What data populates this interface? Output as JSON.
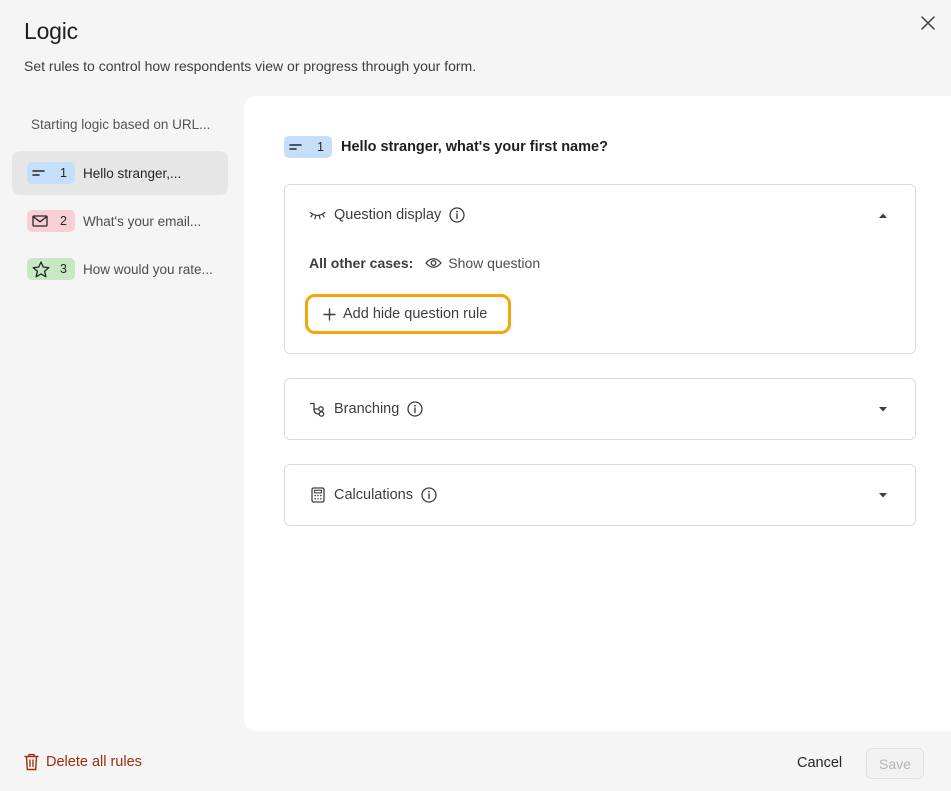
{
  "modal": {
    "title": "Logic",
    "subtitle": "Set rules to control how respondents view or progress through your form.",
    "close_icon": "close-icon"
  },
  "sidebar": {
    "header": "Starting logic based on URL...",
    "items": [
      {
        "number": "1",
        "label": "Hello stranger,...",
        "icon": "short-text-icon",
        "color": "#c5dffa",
        "active": true
      },
      {
        "number": "2",
        "label": "What's your email...",
        "icon": "mail-icon",
        "color": "#f9cfd6",
        "active": false
      },
      {
        "number": "3",
        "label": "How would you rate...",
        "icon": "star-icon",
        "color": "#c7e8c2",
        "active": false
      }
    ]
  },
  "main": {
    "question": {
      "number": "1",
      "title": "Hello stranger, what's your first name?"
    },
    "sections": [
      {
        "title": "Question display",
        "icon": "eye-closed-icon",
        "expanded": true
      },
      {
        "title": "Branching",
        "icon": "branch-icon",
        "expanded": false
      },
      {
        "title": "Calculations",
        "icon": "calculator-icon",
        "expanded": false
      }
    ],
    "display": {
      "cases_label": "All other cases:",
      "show_label": "Show question",
      "add_rule_label": "Add hide question rule"
    }
  },
  "footer": {
    "delete_label": "Delete all rules",
    "cancel_label": "Cancel",
    "save_label": "Save"
  },
  "colors": {
    "highlight": "#f5a40a",
    "danger": "#9c2d0a"
  }
}
